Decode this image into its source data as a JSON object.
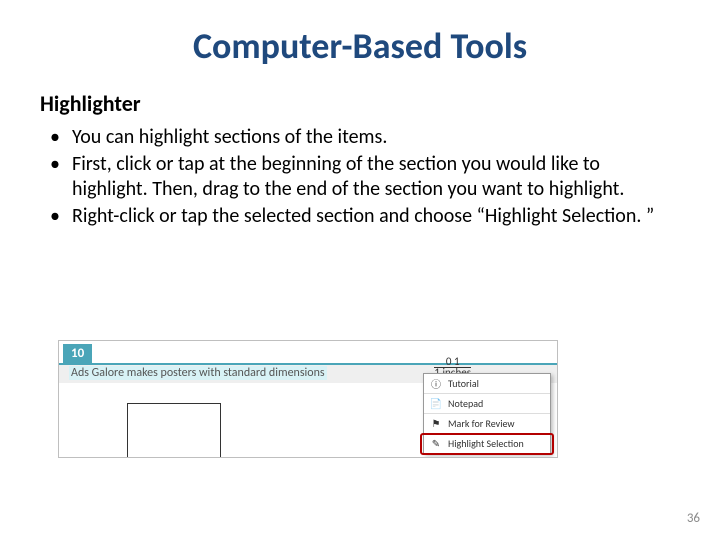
{
  "title": "Computer-Based Tools",
  "subheading": "Highlighter",
  "bullets": [
    "You can highlight sections of the items.",
    "First, click or tap at the beginning of the section you would like to highlight. Then, drag to the end of the section you want to highlight.",
    "Right-click or tap the selected section and choose “Highlight Selection. ”"
  ],
  "figure": {
    "tab_number": "10",
    "prompt_text": "Ads Galore makes posters with standard dimensions",
    "fraction": {
      "top": "0 1",
      "bottom": "1 inches"
    },
    "context_menu": [
      {
        "icon": "info-icon",
        "glyph": "ⓘ",
        "label": "Tutorial"
      },
      {
        "icon": "notepad-icon",
        "glyph": "📄",
        "label": "Notepad"
      },
      {
        "icon": "flag-icon",
        "glyph": "⚑",
        "label": "Mark for Review"
      },
      {
        "icon": "highlighter-icon",
        "glyph": "✎",
        "label": "Highlight Selection"
      }
    ]
  },
  "slide_number": "36"
}
